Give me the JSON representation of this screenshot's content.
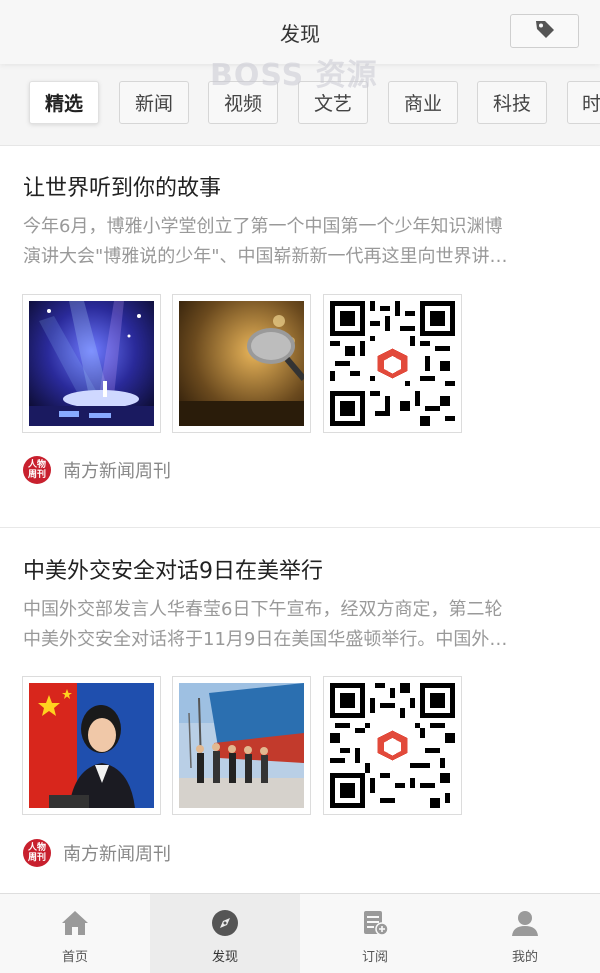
{
  "header": {
    "title": "发现",
    "watermark": "BOSS 资源"
  },
  "categories": [
    {
      "label": "精选",
      "active": true
    },
    {
      "label": "新闻",
      "active": false
    },
    {
      "label": "视频",
      "active": false
    },
    {
      "label": "文艺",
      "active": false
    },
    {
      "label": "商业",
      "active": false
    },
    {
      "label": "科技",
      "active": false
    },
    {
      "label": "时",
      "active": false
    }
  ],
  "articles": [
    {
      "title": "让世界听到你的故事",
      "summary_line1": "今年6月，博雅小学堂创立了第一个中国第一个少年知识渊博",
      "summary_line2": "演讲大会\"博雅说的少年\"、中国崭新新一代再这里向世界讲…",
      "source_logo_text": "人物周刊",
      "source": "南方新闻周刊"
    },
    {
      "title": "中美外交安全对话9日在美举行",
      "summary_line1": "中国外交部发言人华春莹6日下午宣布，经双方商定，第二轮",
      "summary_line2": "中美外交安全对话将于11月9日在美国华盛顿举行。中国外…",
      "source_logo_text": "人物周刊",
      "source": "南方新闻周刊"
    }
  ],
  "tabbar": {
    "items": [
      {
        "label": "首页",
        "icon": "home-icon"
      },
      {
        "label": "发现",
        "icon": "compass-icon"
      },
      {
        "label": "订阅",
        "icon": "subscribe-icon"
      },
      {
        "label": "我的",
        "icon": "user-icon"
      }
    ],
    "active_index": 1
  },
  "colors": {
    "accent_logo": "#c8202e",
    "text_title": "#222222",
    "text_summary": "#999999"
  }
}
